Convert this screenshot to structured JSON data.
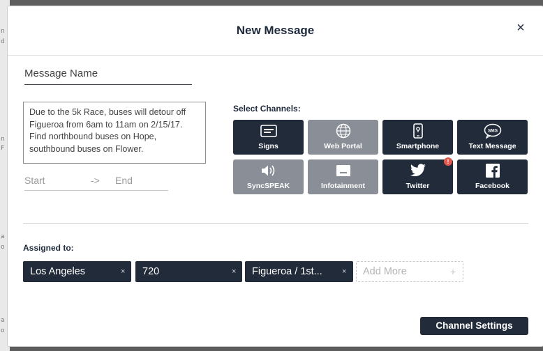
{
  "modal": {
    "title": "New Message",
    "close_label": "×"
  },
  "form": {
    "message_name_placeholder": "Message Name",
    "message_body": "Due to the 5k Race, buses will detour off Figueroa from 6am to 11am on 2/15/17. Find northbound buses on Hope, southbound buses on Flower.",
    "start_label": "Start",
    "arrow": "->",
    "end_label": "End"
  },
  "channels": {
    "label": "Select Channels:",
    "items": [
      {
        "label": "Signs",
        "icon": "sign-icon",
        "state": "selected"
      },
      {
        "label": "Web Portal",
        "icon": "globe-www-icon",
        "state": "unselected"
      },
      {
        "label": "Smartphone",
        "icon": "smartphone-icon",
        "state": "selected"
      },
      {
        "label": "Text Message",
        "icon": "sms-bubble-icon",
        "state": "selected"
      },
      {
        "label": "SyncSPEAK",
        "icon": "speaker-icon",
        "state": "unselected"
      },
      {
        "label": "Infotainment",
        "icon": "screen-icon",
        "state": "unselected"
      },
      {
        "label": "Twitter",
        "icon": "twitter-icon",
        "state": "selected",
        "alert": "!"
      },
      {
        "label": "Facebook",
        "icon": "facebook-icon",
        "state": "selected"
      }
    ]
  },
  "assigned": {
    "label": "Assigned to:",
    "tags": [
      {
        "label": "Los Angeles",
        "remove": "×"
      },
      {
        "label": "720",
        "remove": "×"
      },
      {
        "label": "Figueroa / 1st...",
        "remove": "×"
      }
    ],
    "add_more_placeholder": "Add More",
    "add_more_plus": "+"
  },
  "footer": {
    "settings_label": "Channel Settings"
  },
  "colors": {
    "dark": "#222b3a",
    "grey": "#8a8e97",
    "alert": "#e2574c"
  }
}
